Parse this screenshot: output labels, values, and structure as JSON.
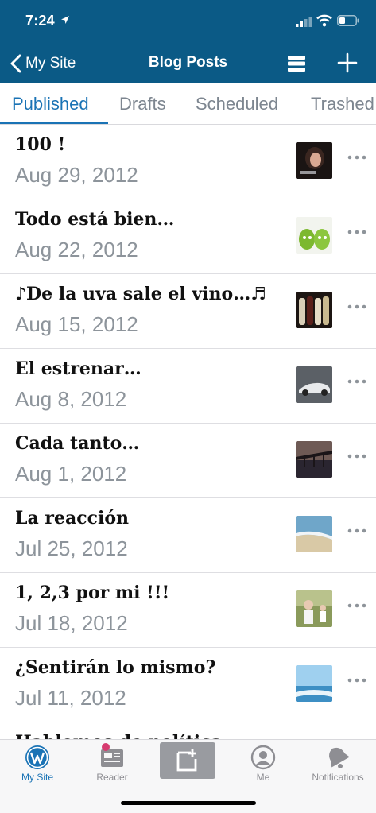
{
  "status_bar": {
    "time": "7:24"
  },
  "nav": {
    "back_label": "My Site",
    "title": "Blog Posts"
  },
  "tabs": [
    "Published",
    "Drafts",
    "Scheduled",
    "Trashed"
  ],
  "posts": [
    {
      "title": "100 !",
      "date": "Aug 29, 2012"
    },
    {
      "title": "Todo está bien…",
      "date": "Aug 22, 2012"
    },
    {
      "title": "♪De la uva sale el vino…♬",
      "date": "Aug 15, 2012"
    },
    {
      "title": "El estrenar…",
      "date": "Aug 8, 2012"
    },
    {
      "title": "Cada tanto…",
      "date": "Aug 1, 2012"
    },
    {
      "title": "La reacción",
      "date": "Jul 25, 2012"
    },
    {
      "title": "1, 2,3 por mi !!!",
      "date": "Jul 18, 2012"
    },
    {
      "title": "¿Sentirán lo mismo?",
      "date": "Jul 11, 2012"
    },
    {
      "title": "Hablemos de política",
      "date": ""
    }
  ],
  "tab_bar": {
    "my_site": "My Site",
    "reader": "Reader",
    "me": "Me",
    "notifications": "Notifications"
  },
  "colors": {
    "brand": "#0b5a86",
    "accent": "#1a73b5",
    "muted": "#8d949b",
    "reader_badge": "#d63b6f"
  }
}
